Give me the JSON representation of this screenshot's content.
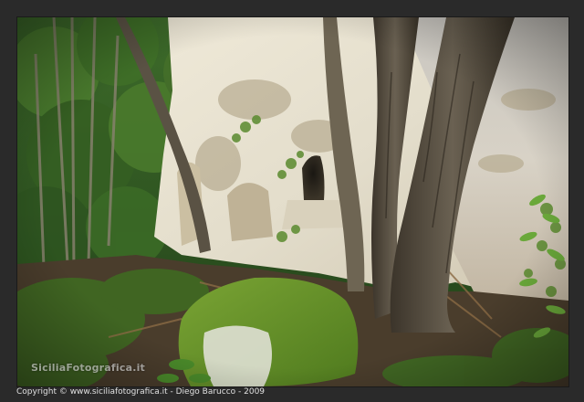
{
  "watermark": "SiciliaFotografica.it",
  "copyright": "Copyright © www.siciliafotografica.it - Diego Barucco -  2009",
  "colors": {
    "frame": "#2a2a2a",
    "rock": "#e6e2d6",
    "moss": "#6f9a2a",
    "foliage": "#2f5a1e",
    "bark": "#4d4538"
  }
}
